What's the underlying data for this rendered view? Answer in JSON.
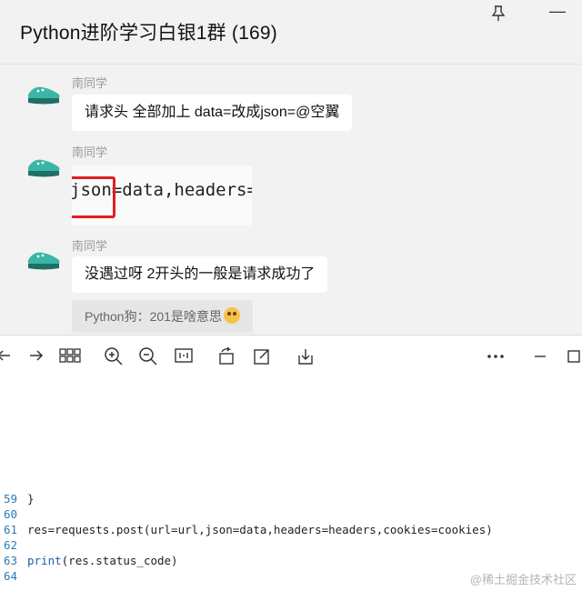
{
  "chat": {
    "title": "Python进阶学习白银1群 (169)",
    "messages": [
      {
        "sender": "南同学",
        "text": "请求头 全部加上 data=改成json=@空翼"
      },
      {
        "sender": "南同学",
        "code_snippet": "json=data,headers="
      },
      {
        "sender": "南同学",
        "text": "没遇过呀 2开头的一般是请求成功了",
        "quote": "Python狗：201是啥意思"
      }
    ]
  },
  "toolbar": {
    "icons": [
      "back-arrow-icon",
      "forward-arrow-icon",
      "grid-view-icon",
      "zoom-in-icon",
      "zoom-out-icon",
      "fit-width-icon",
      "rotate-icon",
      "edit-icon",
      "download-icon",
      "more-icon",
      "minimize-icon",
      "maximize-icon"
    ]
  },
  "editor": {
    "lines": [
      {
        "no": "59",
        "code": "}"
      },
      {
        "no": "60",
        "code": ""
      },
      {
        "no": "61",
        "code": "res=requests.post(url=url,json=data,headers=headers,cookies=cookies)"
      },
      {
        "no": "62",
        "code": ""
      },
      {
        "no": "63",
        "code_kw": "print",
        "code_rest": "(res.status_code)"
      },
      {
        "no": "64",
        "code": ""
      }
    ]
  },
  "watermark": "@稀土掘金技术社区",
  "colors": {
    "chat_bg": "#f2f2f2",
    "highlight": "#e02020",
    "line_number": "#2b7bb9"
  }
}
